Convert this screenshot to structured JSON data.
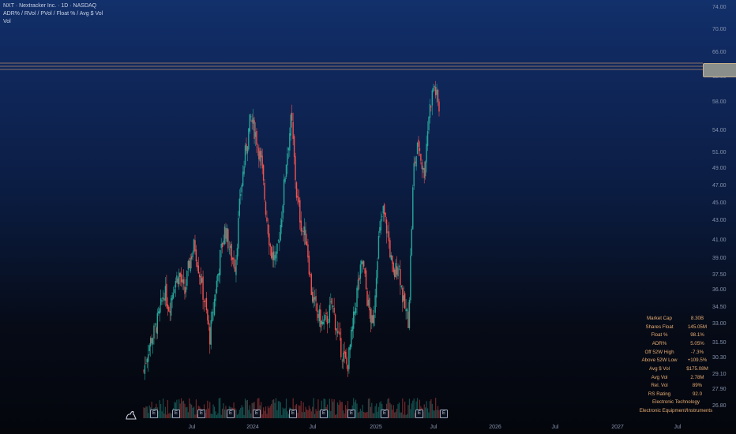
{
  "header": {
    "title": "NXT · Nextracker Inc. · 1D · NASDAQ",
    "indicator_line": "ADR% / RVol / PVol / Float % / Avg $ Vol",
    "volume_label": "Vol"
  },
  "y_axis_ticks": [
    "74.00",
    "70.00",
    "66.00",
    "62.00",
    "58.00",
    "54.00",
    "51.00",
    "49.00",
    "47.00",
    "45.00",
    "43.00",
    "41.00",
    "39.00",
    "37.50",
    "36.00",
    "34.50",
    "33.00",
    "31.50",
    "30.30",
    "29.10",
    "27.90",
    "26.80"
  ],
  "x_axis_ticks": [
    "Jul",
    "2024",
    "Jul",
    "2025",
    "Jul",
    "2026",
    "Jul",
    "2027",
    "Jul"
  ],
  "stats_table": [
    {
      "label": "Market Cap",
      "value": "8.30B"
    },
    {
      "label": "Shares Float",
      "value": "145.05M"
    },
    {
      "label": "Float %",
      "value": "98.1%"
    },
    {
      "label": "ADR%",
      "value": "5.05%"
    },
    {
      "label": "Off 52W High",
      "value": "-7.3%"
    },
    {
      "label": "Above 52W Low",
      "value": "+109.5%"
    },
    {
      "label": "Avg $ Vol",
      "value": "$175.08M"
    },
    {
      "label": "Avg Vol",
      "value": "2.78M"
    },
    {
      "label": "Rel. Vol",
      "value": "89%"
    },
    {
      "label": "RS Rating",
      "value": "92.0"
    }
  ],
  "sector": "Electronic Technology",
  "industry": "Electronic Equipment/Instruments",
  "earnings_marker": "E",
  "colors": {
    "up": "#26a69a",
    "down": "#ef5350",
    "stats": "#e7ad74",
    "hline": "#b98a6a"
  },
  "chart_data": {
    "type": "candlestick",
    "symbol": "NXT",
    "title": "NXT · Nextracker Inc. · 1D · NASDAQ",
    "ylim": [
      26.8,
      74.0
    ],
    "close_approx": [
      31.0,
      34.0,
      35.5,
      37.5,
      40.5,
      38.5,
      41.5,
      42.5,
      40.0,
      44.0,
      46.0,
      42.5,
      39.0,
      35.0,
      40.0,
      44.5,
      48.0,
      45.0,
      43.5,
      52.0,
      57.0,
      61.0,
      59.0,
      56.0,
      50.0,
      45.0,
      44.0,
      49.0,
      56.0,
      61.0,
      52.0,
      48.0,
      46.5,
      40.0,
      38.0,
      36.5,
      37.0,
      39.0,
      35.5,
      33.0,
      31.5,
      36.0,
      41.0,
      44.0,
      39.0,
      36.0,
      46.0,
      50.0,
      47.0,
      42.0,
      44.0,
      39.0,
      37.0,
      55.0,
      58.0,
      54.0,
      61.5,
      65.0,
      62.0
    ],
    "volume_note": "Volume histogram shown along chart bottom"
  }
}
